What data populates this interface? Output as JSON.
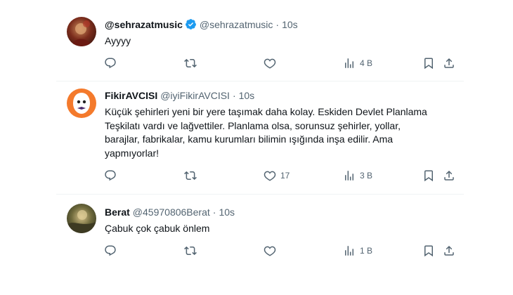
{
  "tweets": [
    {
      "name": "@sehrazatmusic",
      "handle": "@sehrazatmusic",
      "sep": "·",
      "time": "10s",
      "verified": true,
      "text": "Ayyyy",
      "counts": {
        "reply": "",
        "retweet": "",
        "like": "",
        "views": "4 B"
      }
    },
    {
      "name": "FikirAVCISI",
      "handle": "@iyiFikirAVCISI",
      "sep": "·",
      "time": "10s",
      "verified": false,
      "text_lines": [
        "Küçük şehirleri yeni bir yere taşımak daha kolay. Eskiden Devlet Planlama",
        "Teşkilatı vardı ve lağvettiler. Planlama olsa, sorunsuz şehirler, yollar,",
        "barajlar, fabrikalar, kamu kurumları bilimin ışığında inşa edilir. Ama",
        "yapmıyorlar!"
      ],
      "counts": {
        "reply": "",
        "retweet": "",
        "like": "17",
        "views": "3 B"
      }
    },
    {
      "name": "Berat",
      "handle": "@45970806Berat",
      "sep": "·",
      "time": "10s",
      "verified": false,
      "text": "Çabuk çok çabuk önlem",
      "counts": {
        "reply": "",
        "retweet": "",
        "like": "",
        "views": "1 B"
      }
    }
  ],
  "icons": {
    "reply": "reply-icon",
    "retweet": "retweet-icon",
    "like": "like-icon",
    "views": "views-icon",
    "bookmark": "bookmark-icon",
    "share": "share-icon",
    "verified": "verified-badge-icon"
  },
  "colors": {
    "text": "#0f1419",
    "secondary": "#536471",
    "verified": "#1d9bf0",
    "divider": "#eff3f4"
  }
}
